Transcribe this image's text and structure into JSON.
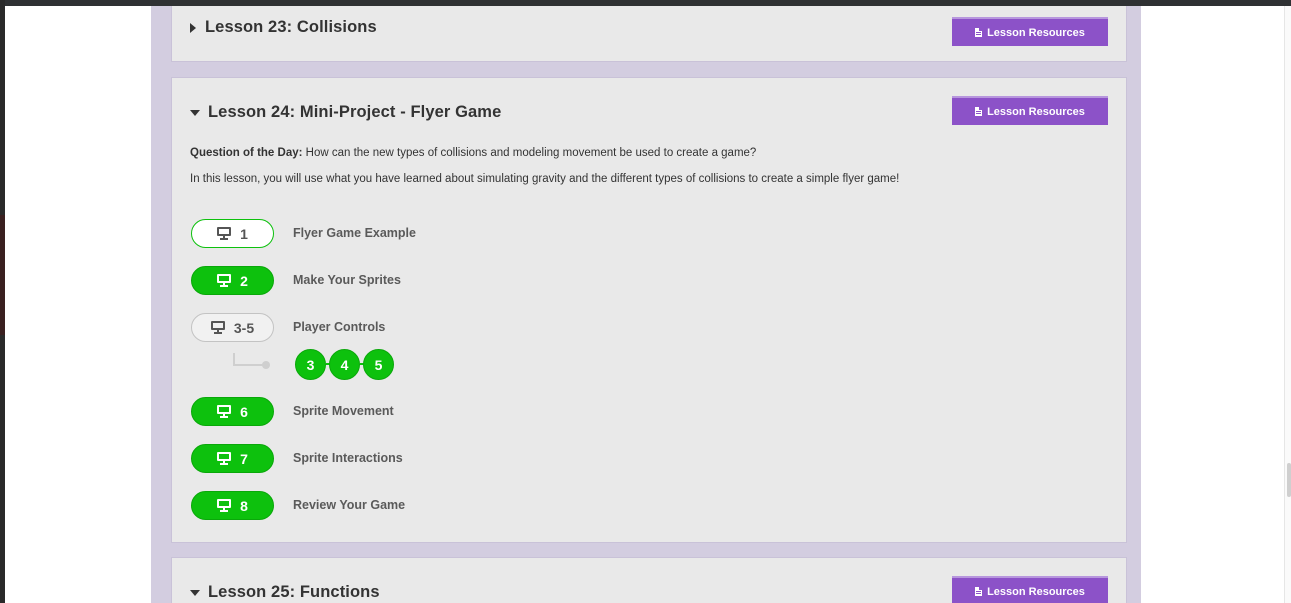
{
  "lessons": {
    "l23": {
      "title": "Lesson 23: Collisions",
      "resources_label": "Lesson Resources"
    },
    "l24": {
      "title": "Lesson 24: Mini-Project - Flyer Game",
      "resources_label": "Lesson Resources",
      "qotd_label": "Question of the Day:",
      "qotd_text": " How can the new types of collisions and modeling movement be used to create a game?",
      "description": "In this lesson, you will use what you have learned about simulating gravity and the different types of collisions to create a simple flyer game!",
      "levels": [
        {
          "number": "1",
          "name": "Flyer Game Example",
          "state": "in-progress"
        },
        {
          "number": "2",
          "name": "Make Your Sprites",
          "state": "done"
        },
        {
          "number": "3-5",
          "name": "Player Controls",
          "state": "group"
        },
        {
          "number": "6",
          "name": "Sprite Movement",
          "state": "done"
        },
        {
          "number": "7",
          "name": "Sprite Interactions",
          "state": "done"
        },
        {
          "number": "8",
          "name": "Review Your Game",
          "state": "done"
        }
      ],
      "sublevels": [
        "3",
        "4",
        "5"
      ]
    },
    "l25": {
      "title": "Lesson 25: Functions",
      "resources_label": "Lesson Resources"
    }
  },
  "colors": {
    "complete_green": "#0dc10d",
    "resources_purple": "#8c52c8",
    "container_lavender": "#d3cde0",
    "card_grey": "#e9e9e9"
  },
  "icons": {
    "level_icon": "monitor-icon",
    "resources_icon": "document-icon",
    "collapsed": "caret-right-icon",
    "expanded": "caret-down-icon"
  }
}
